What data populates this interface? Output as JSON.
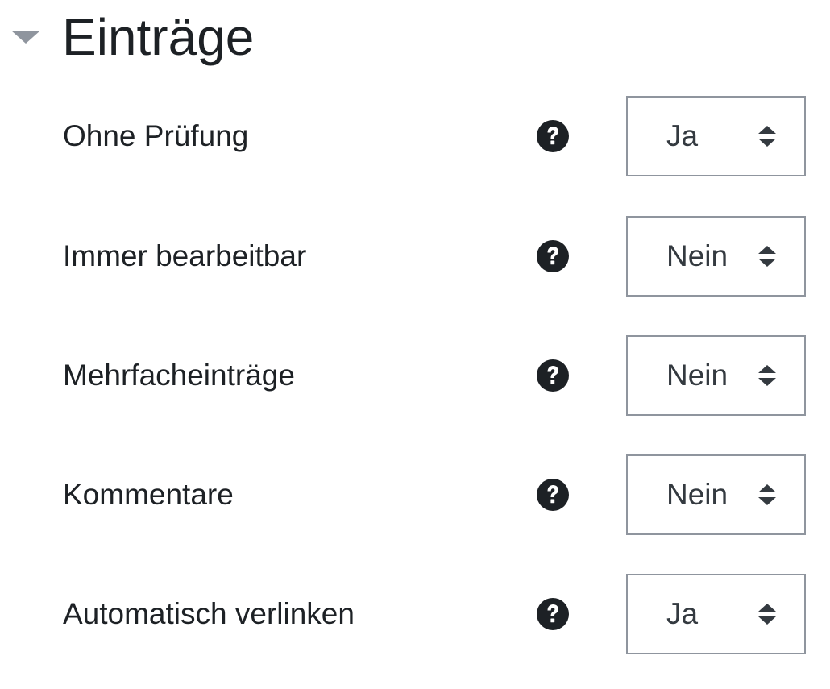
{
  "section": {
    "title": "Einträge",
    "toggle_icon": "caret-down-icon"
  },
  "settings": [
    {
      "label": "Ohne Prüfung",
      "help_icon": "question-circle-icon",
      "value": "Ja"
    },
    {
      "label": "Immer bearbeitbar",
      "help_icon": "question-circle-icon",
      "value": "Nein"
    },
    {
      "label": "Mehrfacheinträge",
      "help_icon": "question-circle-icon",
      "value": "Nein"
    },
    {
      "label": "Kommentare",
      "help_icon": "question-circle-icon",
      "value": "Nein"
    },
    {
      "label": "Automatisch verlinken",
      "help_icon": "question-circle-icon",
      "value": "Ja"
    }
  ],
  "colors": {
    "text": "#1d2125",
    "icon": "#1d2125",
    "toggle": "#8f959e",
    "select_border": "#8f959e",
    "select_text": "#343a40"
  }
}
